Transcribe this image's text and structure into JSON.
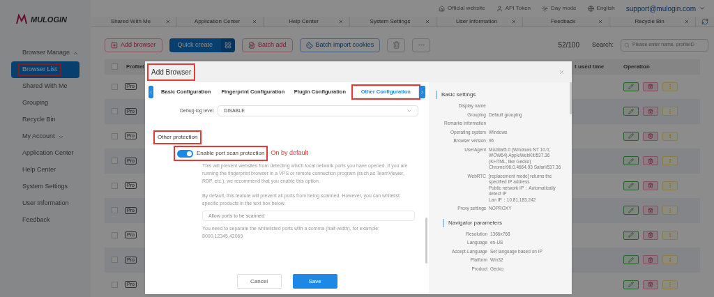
{
  "header": {
    "logo": "MULOGIN",
    "links": [
      "Official website",
      "API Token",
      "Day mode",
      "English"
    ],
    "account": "support@mulogin.com"
  },
  "tabs": [
    "Shared With Me",
    "Application Center",
    "Help Center",
    "System Settings",
    "User Information",
    "Feedback",
    "Recycle Bin"
  ],
  "sidebar": [
    {
      "label": "Browser Manage",
      "expanded": true,
      "children": [
        {
          "label": "Browser List",
          "selected": true,
          "annotated": true
        },
        {
          "label": "Shared With Me",
          "selected": false,
          "annotated": false
        },
        {
          "label": "Grouping",
          "selected": false,
          "annotated": false
        },
        {
          "label": "Recycle Bin",
          "selected": false,
          "annotated": false
        }
      ]
    },
    {
      "label": "My Account",
      "expanded": false
    },
    {
      "label": "Application Center"
    },
    {
      "label": "Help Center"
    },
    {
      "label": "System Settings"
    },
    {
      "label": "User Information"
    },
    {
      "label": "Feedback"
    }
  ],
  "toolbar": {
    "buttons": [
      {
        "kind": "add",
        "label": "Add browser"
      },
      {
        "kind": "quick",
        "label": "Quick create"
      },
      {
        "kind": "batch",
        "label": "Batch add"
      },
      {
        "kind": "import",
        "label": "Batch import cookies"
      },
      {
        "kind": "trash"
      },
      {
        "kind": "more"
      }
    ],
    "count": "52/100",
    "search_label": "Search:",
    "search": {
      "placeholder": "Please enter name, profileID"
    }
  },
  "table": {
    "header_checked": false,
    "columns": [
      "ProfileI",
      "t used time",
      "Operation"
    ],
    "rows": [
      {
        "checked": false,
        "badge": "Pro"
      },
      {
        "checked": false,
        "badge": "Pro"
      },
      {
        "checked": false,
        "badge": "Pro"
      },
      {
        "checked": false,
        "badge": "Pro"
      },
      {
        "checked": false,
        "badge": "Pro"
      },
      {
        "checked": false,
        "badge": "Pro"
      },
      {
        "checked": false,
        "badge": "Pro"
      },
      {
        "checked": false,
        "badge": "Pro"
      },
      {
        "checked": false,
        "badge": "Pro"
      }
    ]
  },
  "modal": {
    "title": "Add Browser",
    "title_annotated": true,
    "tabs": [
      {
        "label": "Basic Configuration",
        "selected": false,
        "annotated": false
      },
      {
        "label": "Fingerprint Configuration",
        "selected": false,
        "annotated": false
      },
      {
        "label": "Plugin Configuration",
        "selected": false,
        "annotated": false
      },
      {
        "label": "Other Configuration",
        "selected": true,
        "annotated": true
      }
    ],
    "debug": {
      "label": "Debug log level",
      "value": "DISABLE"
    },
    "section": {
      "title": "Other protection",
      "annotated": true
    },
    "toggle": {
      "label": "Enable port scan protection",
      "on": true,
      "annotated": true,
      "note": "On by default"
    },
    "paragraphs": [
      "This will prevent websites from detecting which local network ports you have opened. If you are running the fingerprint browser in a VPS or remote connection program (such as TeamViewer, RDP, etc.), we recommend that you enable this option.",
      "By default, this feature will prevent all ports from being scanned. However, you can whitelist specific products in the text box below."
    ],
    "ports": {
      "placeholder": "Allow ports to be scanned"
    },
    "hint": "You need to separate the whitelisted ports with a comma (half-width), for example: 8000,12345,42069",
    "buttons": [
      {
        "kind": "cancel",
        "label": "Cancel"
      },
      {
        "kind": "save",
        "label": "Save"
      }
    ],
    "summary": [
      {
        "title": "Basic settings",
        "fields": [
          {
            "label": "Display name"
          },
          {
            "label": "Grouping",
            "value": "Default grouping"
          },
          {
            "label": "Remarks information"
          },
          {
            "label": "Operating system",
            "value": "Windows"
          },
          {
            "label": "Browser version",
            "value": "96"
          },
          {
            "label": "UserAgent",
            "value": "Mozilla/5.0 (Windows NT 10.0; WOW64) AppleWebKit/537.36 (KHTML, like Gecko) Chrome/96.0.4664.93 Safari/537.36"
          },
          {
            "label": "WebRTC",
            "value": [
              "[replacement mode] returns the specified IP address",
              "Public network IP：Automatically detect IP",
              "Lan IP：10.81.183.242"
            ]
          },
          {
            "label": "Proxy settings",
            "value": "NOPROXY"
          }
        ]
      },
      {
        "title": "Navigator parameters",
        "fields": [
          {
            "label": "Resolution",
            "value": "1366x768"
          },
          {
            "label": "Language",
            "value": "en-US"
          },
          {
            "label": "Accept-Language",
            "value": "Set language based on IP"
          },
          {
            "label": "Platform",
            "value": "Win32"
          },
          {
            "label": "Product",
            "value": "Gecko"
          }
        ]
      }
    ]
  }
}
